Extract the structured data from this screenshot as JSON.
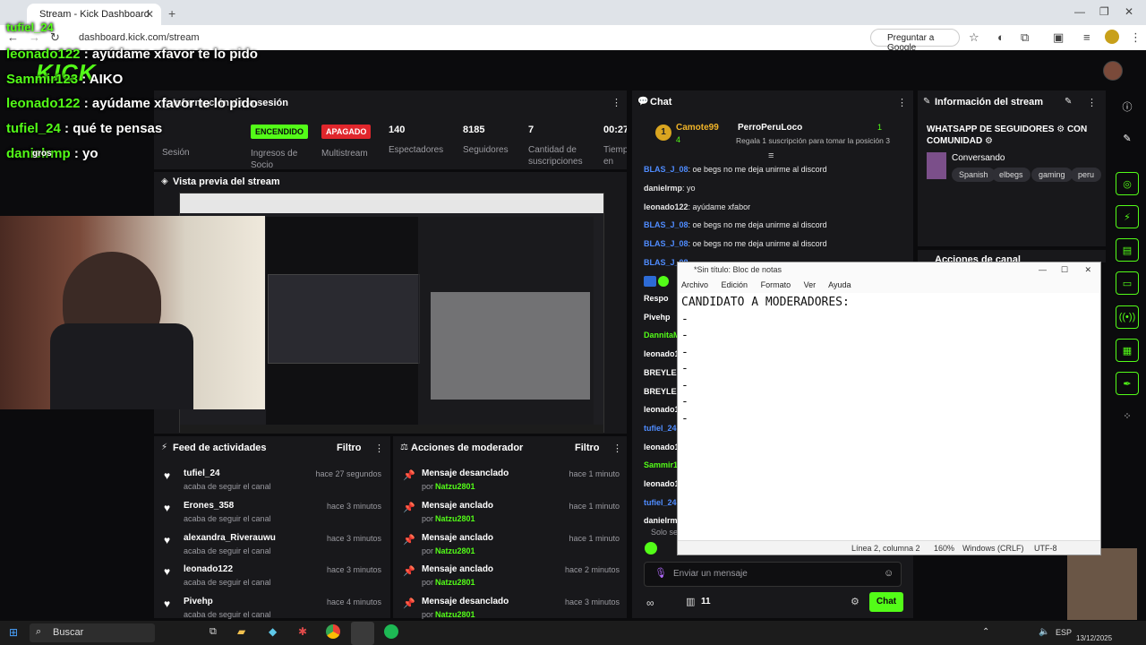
{
  "browser": {
    "tab_title": "Stream - Kick Dashboard",
    "url": "dashboard.kick.com/stream",
    "google_pill": "Preguntar a Google"
  },
  "session": {
    "header": "Información de la sesión",
    "stats": [
      {
        "value": "Sesión",
        "label": ""
      },
      {
        "badge": "ENCENDIDO",
        "label": "Ingresos de Socio"
      },
      {
        "badge": "APAGADO",
        "label": "Multistream"
      },
      {
        "value": "140",
        "label": "Espectadores"
      },
      {
        "value": "8185",
        "label": "Seguidores"
      },
      {
        "value": "7",
        "label": "Cantidad de suscripciones"
      },
      {
        "value": "00:27",
        "label": "Tiempo en vivo"
      }
    ]
  },
  "preview": {
    "header": "Vista previa del stream"
  },
  "activity": {
    "header": "Feed de actividades",
    "filter": "Filtro",
    "items": [
      {
        "name": "tufiel_24",
        "sub": "acaba de seguir el canal",
        "time": "hace 27 segundos"
      },
      {
        "name": "Erones_358",
        "sub": "acaba de seguir el canal",
        "time": "hace 3 minutos"
      },
      {
        "name": "alexandra_Riverauwu",
        "sub": "acaba de seguir el canal",
        "time": "hace 3 minutos"
      },
      {
        "name": "leonado122",
        "sub": "acaba de seguir el canal",
        "time": "hace 3 minutos"
      },
      {
        "name": "Pivehp",
        "sub": "acaba de seguir el canal",
        "time": "hace 4 minutos"
      }
    ]
  },
  "modactions": {
    "header": "Acciones de moderador",
    "filter": "Filtro",
    "items": [
      {
        "action": "Mensaje desanclado",
        "by": "por",
        "mod": "Natzu2801",
        "time": "hace 1 minuto"
      },
      {
        "action": "Mensaje anclado",
        "by": "por",
        "mod": "Natzu2801",
        "time": "hace 1 minuto"
      },
      {
        "action": "Mensaje anclado",
        "by": "por",
        "mod": "Natzu2801",
        "time": "hace 1 minuto"
      },
      {
        "action": "Mensaje anclado",
        "by": "por",
        "mod": "Natzu2801",
        "time": "hace 2 minutos"
      },
      {
        "action": "Mensaje desanclado",
        "by": "por",
        "mod": "Natzu2801",
        "time": "hace 3 minutos"
      }
    ]
  },
  "chat": {
    "header": "Chat",
    "top_gifter": {
      "name": "Camote99",
      "count": "4",
      "rank": "1"
    },
    "gift_target": {
      "name": "PerroPeruLoco",
      "count": "1",
      "text": "Regala 1 suscripción para tomar la posición 3"
    },
    "messages": [
      {
        "user": "BLAS_J_08",
        "text": ": oe begs no me deja unirme al discord",
        "color": "#4f8cff"
      },
      {
        "user": "danielrmp",
        "text": ": yo",
        "color": "#e8e8e8"
      },
      {
        "user": "leonado122",
        "text": ": ayúdame xfabor",
        "color": "#e8e8e8"
      },
      {
        "user": "BLAS_J_08",
        "text": ": oe begs no me deja unirme al discord",
        "color": "#4f8cff"
      },
      {
        "user": "BLAS_J_08",
        "text": ": oe begs no me deja unirme al discord",
        "color": "#4f8cff"
      },
      {
        "user": "BLAS_J_08",
        "text": "",
        "color": "#4f8cff"
      }
    ],
    "partial_users": [
      "Respo",
      "Pivehp",
      "DannitaM",
      "leonado1",
      "BREYLEX",
      "BREYLEX",
      "leonado1",
      "tufiel_24",
      "leonado1",
      "Sammir1",
      "leonado1",
      "tufiel_24",
      "danielrm"
    ],
    "solo_se": "Solo se",
    "input_placeholder": "Enviar un mensaje",
    "points": "11",
    "send": "Chat"
  },
  "streaminfo": {
    "header": "Información del stream",
    "title": "WHATSAPP DE SEGUIDORES ⚙ CON COMUNIDAD ⚙",
    "category": "Conversando",
    "tags": [
      "Spanish",
      "elbegs",
      "gaming",
      "peru"
    ],
    "mod_actions_header": "Acciones de canal"
  },
  "overlay": {
    "lines": [
      {
        "user": "leonado122",
        "text": " : ayúdame xfavor te lo pido"
      },
      {
        "user": "Sammir123",
        "text": " : AIKO"
      },
      {
        "user": "leonado122",
        "text": " : ayúdame xfavor te lo pido"
      },
      {
        "user": "tufiel_24",
        "text": " : qué te pensas"
      },
      {
        "user": "danielrmp",
        "text": " : yo"
      }
    ],
    "top_user": "tufiel_24",
    "gros": "gros",
    "stream_word": "Stream"
  },
  "notepad": {
    "title": "*Sin título: Bloc de notas",
    "menu": [
      "Archivo",
      "Edición",
      "Formato",
      "Ver",
      "Ayuda"
    ],
    "text": "CANDIDATO A MODERADORES:\n-\n-\n-\n-\n-\n-\n-",
    "status": {
      "pos": "Línea 2, columna 2",
      "zoom": "160%",
      "eol": "Windows (CRLF)",
      "enc": "UTF-8"
    }
  },
  "taskbar": {
    "search": "Buscar",
    "lang": "ESP",
    "date": "13/12/2025"
  },
  "colors": {
    "kick_green": "#53fc18",
    "panel": "#18181b",
    "bg": "#0b0b0d"
  }
}
